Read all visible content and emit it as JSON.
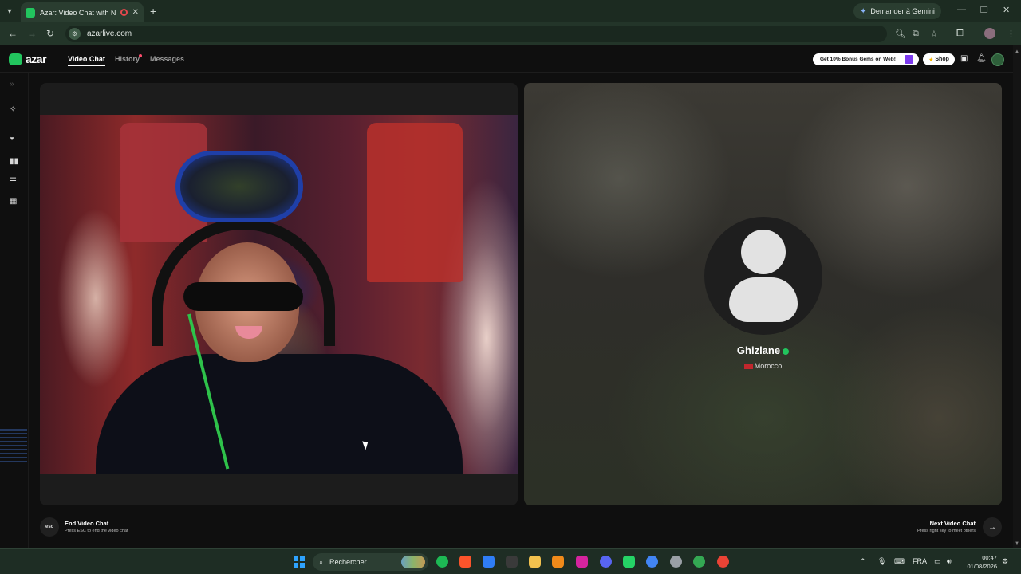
{
  "browser": {
    "tab_title": "Azar: Video Chat with New",
    "new_tab": "+",
    "gemini_label": "Demander à Gemini",
    "url": "azarlive.com"
  },
  "header": {
    "logo": "azar",
    "nav": [
      {
        "label": "Video Chat"
      },
      {
        "label": "History"
      },
      {
        "label": "Messages"
      }
    ],
    "promo": "Get 10% Bonus Gems on Web!",
    "shop": "Shop"
  },
  "peer": {
    "name": "Ghizlane",
    "country": "Morocco"
  },
  "footer": {
    "esc_key": "esc",
    "end_title": "End Video Chat",
    "end_sub": "Press ESC to end the video chat",
    "next_title": "Next Video Chat",
    "next_sub": "Press right key to meet others"
  },
  "taskbar": {
    "search_placeholder": "Rechercher",
    "lang": "FRA",
    "time": "00:47",
    "date": "01/08/2026"
  },
  "colors": {
    "brand": "#22c55e",
    "chrome": "#1c2b21",
    "bg": "#0f0f0f"
  }
}
